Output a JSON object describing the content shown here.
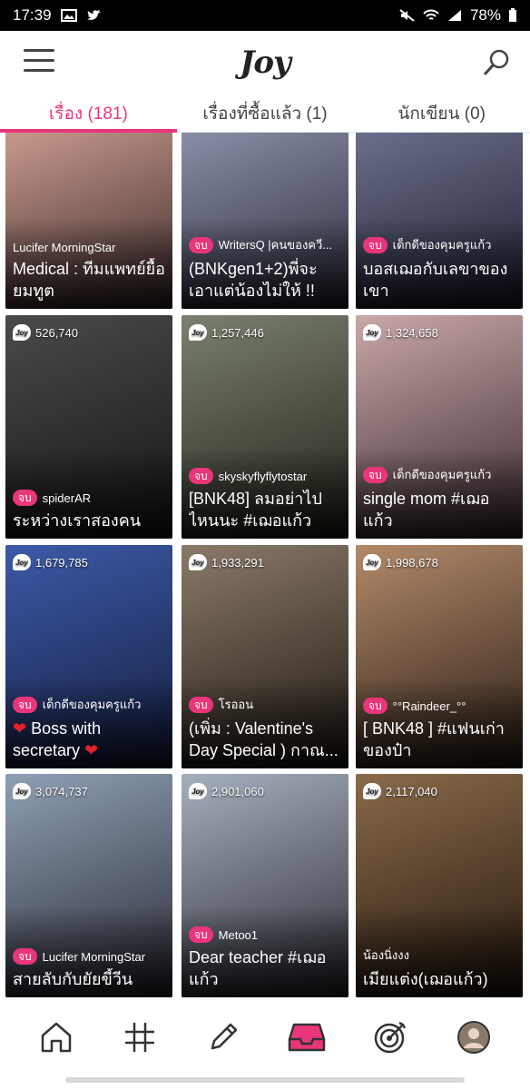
{
  "status": {
    "time": "17:39",
    "battery": "78%"
  },
  "app": {
    "logo": "Joy"
  },
  "tabs": [
    {
      "label": "เรื่อง (181)",
      "active": true
    },
    {
      "label": "เรื่องที่ซื้อแล้ว (1)",
      "active": false
    },
    {
      "label": "นักเขียน (0)",
      "active": false
    }
  ],
  "cards": [
    {
      "views": "",
      "end": false,
      "author": "Lucifer MorningStar",
      "title": "Medical : ทีมแพทย์ยื้อยมทูต",
      "bg": [
        "#c99a8e",
        "#3a2a2a"
      ]
    },
    {
      "views": "",
      "end": true,
      "end_label": "จบ",
      "author": "WritersQ |คนของควี...",
      "title": "(BNKgen1+2)พี่จะเอาแต่น้องไม่ให้ !!",
      "bg": [
        "#8a8fa8",
        "#2b2c3a"
      ]
    },
    {
      "views": "",
      "end": true,
      "end_label": "จบ",
      "author": "เด็กดีของคุมครูแก้ว",
      "title": "บอสเฌอกับเลขาของเขา",
      "bg": [
        "#6b6f8a",
        "#1e2030"
      ]
    },
    {
      "views": "526,740",
      "end": true,
      "end_label": "จบ",
      "author": "spiderAR",
      "title": "ระหว่างเราสองคน",
      "bg": [
        "#4a4a4a",
        "#151515"
      ]
    },
    {
      "views": "1,257,446",
      "end": true,
      "end_label": "จบ",
      "author": "skyskyflyflytostar",
      "title": "[BNK48] ลมอย่าไปไหนนะ #เฌอแก้ว",
      "bg": [
        "#7a8070",
        "#202218"
      ]
    },
    {
      "views": "1,324,658",
      "end": true,
      "end_label": "จบ",
      "author": "เด็กดีของคุมครูแก้ว",
      "title": "single mom #เฌอแก้ว",
      "bg": [
        "#c9a8a8",
        "#3a2a2e"
      ]
    },
    {
      "views": "1,679,785",
      "end": true,
      "end_label": "จบ",
      "author": "เด็กดีของคุมครูแก้ว",
      "title": "Boss with secretary",
      "heart": "❤",
      "bg": [
        "#3c5aa8",
        "#141c3c"
      ]
    },
    {
      "views": "1,933,291",
      "end": true,
      "end_label": "จบ",
      "author": "โรออน",
      "title": "(เพิ่ม : Valentine's Day Special ) กาณ...",
      "bg": [
        "#8a7a6a",
        "#1e1812"
      ]
    },
    {
      "views": "1,998,678",
      "end": true,
      "end_label": "จบ",
      "author": "°°Raindeer_°°",
      "title": "[ BNK48 ] #แฟนเก่าของป๋า",
      "bg": [
        "#b38a6a",
        "#2a1e16"
      ]
    },
    {
      "views": "3,074,737",
      "end": true,
      "end_label": "จบ",
      "author": "Lucifer MorningStar",
      "title": "สายลับกับยัยขี้วีน",
      "bg": [
        "#8fa0b5",
        "#2a2a33"
      ]
    },
    {
      "views": "2,901,060",
      "end": true,
      "end_label": "จบ",
      "author": "Metoo1",
      "title": "Dear teacher #เฌอแก้ว",
      "bg": [
        "#a6b0bd",
        "#2c2c34"
      ]
    },
    {
      "views": "2,117,040",
      "end": false,
      "author": "น้องนิ่งงง",
      "title": "เมียแต่ง(เฌอแก้ว)",
      "bg": [
        "#8a6a4a",
        "#24180e"
      ]
    }
  ],
  "nav": [
    "home-icon",
    "hashtag-icon",
    "pencil-icon",
    "inbox-icon",
    "target-icon",
    "profile-avatar"
  ],
  "colors": {
    "accent": "#e9357a"
  }
}
